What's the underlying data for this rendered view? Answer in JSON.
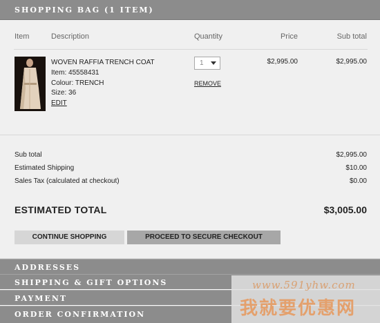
{
  "header": {
    "title": "Shopping Bag (1 item)"
  },
  "table": {
    "columns": {
      "item": "Item",
      "description": "Description",
      "quantity": "Quantity",
      "price": "Price",
      "subtotal": "Sub total"
    }
  },
  "product": {
    "name": "WOVEN RAFFIA TRENCH COAT",
    "item_number": "Item: 45558431",
    "colour": "Colour: TRENCH",
    "size": "Size: 36",
    "edit_label": "EDIT",
    "quantity": "1",
    "remove_label": "REMOVE",
    "price": "$2,995.00",
    "line_total": "$2,995.00"
  },
  "summary": {
    "subtotal_label": "Sub total",
    "subtotal_value": "$2,995.00",
    "shipping_label": "Estimated Shipping",
    "shipping_value": "$10.00",
    "tax_label": "Sales Tax (calculated at checkout)",
    "tax_value": "$0.00",
    "total_label": "ESTIMATED TOTAL",
    "total_value": "$3,005.00"
  },
  "buttons": {
    "continue": "CONTINUE SHOPPING",
    "checkout": "PROCEED TO SECURE CHECKOUT"
  },
  "sections": [
    "Addresses",
    "Shipping & Gift Options",
    "Payment",
    "Order Confirmation"
  ],
  "watermark": {
    "url": "www.591yhw.com",
    "text": "我就要优惠网"
  },
  "colors": {
    "header_bar": "#8c8c8c",
    "panel": "#f0f0f0",
    "checkout_button": "#a7a7a7",
    "continue_button": "#d6d6d6"
  }
}
